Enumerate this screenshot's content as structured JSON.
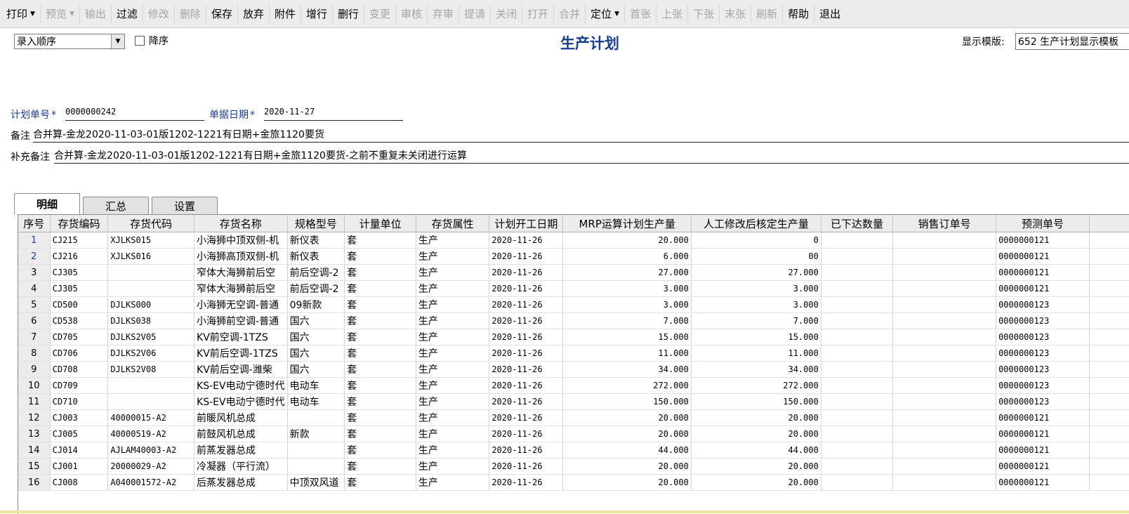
{
  "toolbar": [
    {
      "label": "打印",
      "enabled": true,
      "dropdown": true,
      "name": "print-button"
    },
    {
      "label": "预览",
      "enabled": false,
      "dropdown": true,
      "name": "preview-button"
    },
    {
      "label": "输出",
      "enabled": false,
      "name": "export-button"
    },
    {
      "label": "过滤",
      "enabled": true,
      "name": "filter-button"
    },
    {
      "label": "修改",
      "enabled": false,
      "name": "edit-button"
    },
    {
      "label": "删除",
      "enabled": false,
      "name": "delete-button"
    },
    {
      "label": "保存",
      "enabled": true,
      "name": "save-button"
    },
    {
      "label": "放弃",
      "enabled": true,
      "name": "discard-button"
    },
    {
      "label": "附件",
      "enabled": true,
      "name": "attachment-button"
    },
    {
      "label": "增行",
      "enabled": true,
      "name": "add-row-button"
    },
    {
      "label": "删行",
      "enabled": true,
      "name": "delete-row-button"
    },
    {
      "label": "变更",
      "enabled": false,
      "name": "change-button"
    },
    {
      "label": "审核",
      "enabled": false,
      "name": "approve-button"
    },
    {
      "label": "弃审",
      "enabled": false,
      "name": "unapprove-button"
    },
    {
      "label": "提请",
      "enabled": false,
      "name": "submit-button"
    },
    {
      "label": "关闭",
      "enabled": false,
      "name": "close-doc-button"
    },
    {
      "label": "打开",
      "enabled": false,
      "name": "open-doc-button"
    },
    {
      "label": "合并",
      "enabled": false,
      "name": "merge-button"
    },
    {
      "label": "定位",
      "enabled": true,
      "dropdown": true,
      "name": "locate-button"
    },
    {
      "label": "首张",
      "enabled": false,
      "name": "first-record-button"
    },
    {
      "label": "上张",
      "enabled": false,
      "name": "prev-record-button"
    },
    {
      "label": "下张",
      "enabled": false,
      "name": "next-record-button"
    },
    {
      "label": "末张",
      "enabled": false,
      "name": "last-record-button"
    },
    {
      "label": "刷新",
      "enabled": false,
      "name": "refresh-button"
    },
    {
      "label": "帮助",
      "enabled": true,
      "name": "help-button"
    },
    {
      "label": "退出",
      "enabled": true,
      "name": "exit-button"
    }
  ],
  "header": {
    "sort_select": "录入顺序",
    "desc_label": "降序",
    "title": "生产计划",
    "template_label": "显示模版:",
    "template_value": "652 生产计划显示模板"
  },
  "form": {
    "plan_no_label": "计划单号",
    "plan_no": "0000000242",
    "date_label": "单据日期",
    "date": "2020-11-27",
    "required_mark": "*",
    "remark_label": "备注",
    "remark": "合并算-金龙2020-11-03-01版1202-1221有日期+金旅1120要货",
    "extra_remark_label": "补充备注",
    "extra_remark": "合并算-金龙2020-11-03-01版1202-1221有日期+金旅1120要货-之前不重复未关闭进行运算"
  },
  "tabs": [
    "明细",
    "汇总",
    "设置"
  ],
  "table": {
    "columns": [
      "序号",
      "存货编码",
      "存货代码",
      "存货名称",
      "规格型号",
      "计量单位",
      "存货属性",
      "计划开工日期",
      "MRP运算计划生产量",
      "人工修改后核定生产量",
      "已下达数量",
      "销售订单号",
      "预测单号"
    ],
    "rows": [
      [
        "1",
        "CJ215",
        "XJLKS015",
        "小海狮中顶双侧-机",
        "新仪表",
        "套",
        "生产",
        "2020-11-26",
        "20.000",
        "0",
        "",
        "",
        "0000000121"
      ],
      [
        "2",
        "CJ216",
        "XJLKS016",
        "小海狮高顶双侧-机",
        "新仪表",
        "套",
        "生产",
        "2020-11-26",
        "6.000",
        "00",
        "",
        "",
        "0000000121"
      ],
      [
        "3",
        "CJ305",
        "",
        "窄体大海狮前后空",
        "前后空调-2",
        "套",
        "生产",
        "2020-11-26",
        "27.000",
        "27.000",
        "",
        "",
        "0000000121"
      ],
      [
        "4",
        "CJ305",
        "",
        "窄体大海狮前后空",
        "前后空调-2",
        "套",
        "生产",
        "2020-11-26",
        "3.000",
        "3.000",
        "",
        "",
        "0000000121"
      ],
      [
        "5",
        "CD500",
        "DJLKS000",
        "小海狮无空调-普通",
        "09新款",
        "套",
        "生产",
        "2020-11-26",
        "3.000",
        "3.000",
        "",
        "",
        "0000000123"
      ],
      [
        "6",
        "CD538",
        "DJLKS038",
        "小海狮前空调-普通",
        "国六",
        "套",
        "生产",
        "2020-11-26",
        "7.000",
        "7.000",
        "",
        "",
        "0000000123"
      ],
      [
        "7",
        "CD705",
        "DJLKS2V05",
        "KV前空调-1TZS",
        "国六",
        "套",
        "生产",
        "2020-11-26",
        "15.000",
        "15.000",
        "",
        "",
        "0000000123"
      ],
      [
        "8",
        "CD706",
        "DJLKS2V06",
        "KV前后空调-1TZS",
        "国六",
        "套",
        "生产",
        "2020-11-26",
        "11.000",
        "11.000",
        "",
        "",
        "0000000123"
      ],
      [
        "9",
        "CD708",
        "DJLKS2V08",
        "KV前后空调-潍柴",
        "国六",
        "套",
        "生产",
        "2020-11-26",
        "34.000",
        "34.000",
        "",
        "",
        "0000000123"
      ],
      [
        "10",
        "CD709",
        "",
        "KS-EV电动宁德时代",
        "电动车",
        "套",
        "生产",
        "2020-11-26",
        "272.000",
        "272.000",
        "",
        "",
        "0000000123"
      ],
      [
        "11",
        "CD710",
        "",
        "KS-EV电动宁德时代",
        "电动车",
        "套",
        "生产",
        "2020-11-26",
        "150.000",
        "150.000",
        "",
        "",
        "0000000123"
      ],
      [
        "12",
        "CJ003",
        "40000015-A2",
        "前暖风机总成",
        "",
        "套",
        "生产",
        "2020-11-26",
        "20.000",
        "20.000",
        "",
        "",
        "0000000121"
      ],
      [
        "13",
        "CJ005",
        "40000519-A2",
        "前鼓风机总成",
        "新款",
        "套",
        "生产",
        "2020-11-26",
        "20.000",
        "20.000",
        "",
        "",
        "0000000121"
      ],
      [
        "14",
        "CJ014",
        "AJLAM40003-A2",
        "前蒸发器总成",
        "",
        "套",
        "生产",
        "2020-11-26",
        "44.000",
        "44.000",
        "",
        "",
        "0000000121"
      ],
      [
        "15",
        "CJ001",
        "20000029-A2",
        "冷凝器（平行流）",
        "",
        "套",
        "生产",
        "2020-11-26",
        "20.000",
        "20.000",
        "",
        "",
        "0000000121"
      ],
      [
        "16",
        "CJ008",
        "A040001572-A2",
        "后蒸发器总成",
        "中顶双风道",
        "套",
        "生产",
        "2020-11-26",
        "20.000",
        "20.000",
        "",
        "",
        "0000000121"
      ]
    ]
  }
}
